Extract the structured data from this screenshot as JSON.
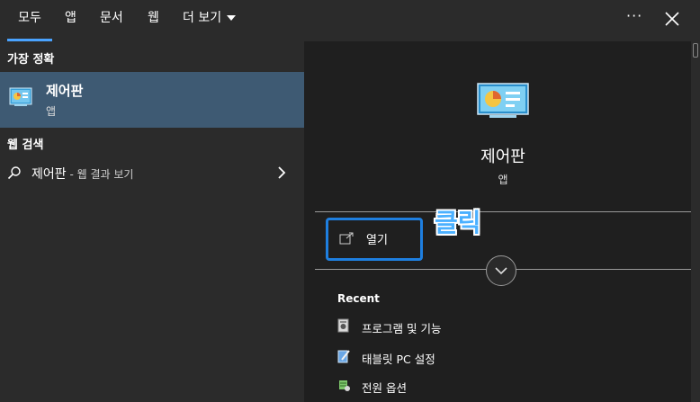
{
  "tabs": [
    {
      "label": "모두",
      "active": true
    },
    {
      "label": "앱"
    },
    {
      "label": "문서"
    },
    {
      "label": "웹"
    },
    {
      "label": "더 보기"
    }
  ],
  "top_actions": {
    "more_icon": "ellipsis-icon",
    "close_icon": "close-icon"
  },
  "left": {
    "best_match_title": "가장 정확",
    "best_match": {
      "name": "제어판",
      "type": "앱",
      "icon": "control-panel-icon"
    },
    "web_search_title": "웹 검색",
    "web_search": {
      "term": "제어판",
      "suffix": " - 웹 결과 보기"
    }
  },
  "detail": {
    "app_name": "제어판",
    "app_type": "앱",
    "open_label": "열기",
    "annotation": "클릭",
    "recent_title": "Recent",
    "recent": [
      {
        "label": "프로그램 및 기능",
        "icon": "programs-icon"
      },
      {
        "label": "태블릿 PC 설정",
        "icon": "tablet-settings-icon"
      },
      {
        "label": "전원 옵션",
        "icon": "power-options-icon"
      }
    ]
  },
  "colors": {
    "accent": "#4aa3ff",
    "selected_row": "#3e5a73",
    "highlight_box": "#1e7fe0",
    "panel": "#1f1f1f",
    "background": "#2b2b2b"
  }
}
